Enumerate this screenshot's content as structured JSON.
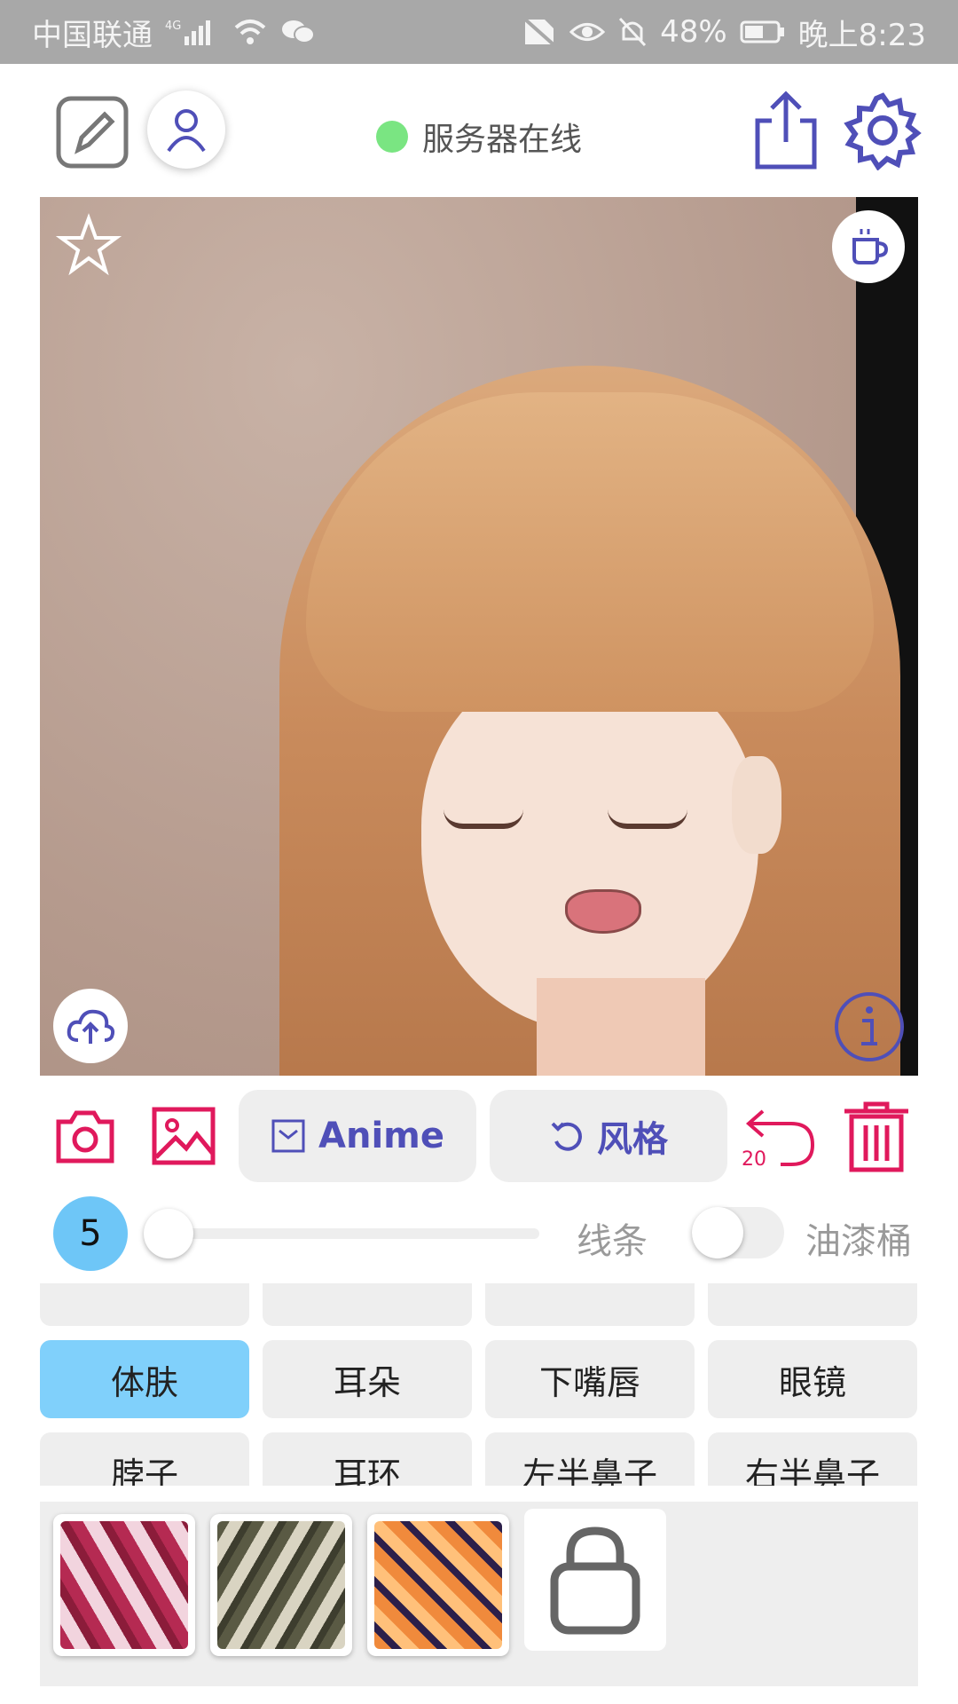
{
  "status_bar": {
    "carrier": "中国联通",
    "network": "4G",
    "battery": "48%",
    "time": "晚上8:23"
  },
  "header": {
    "server_status": "服务器在线",
    "status_color": "#7ae582"
  },
  "toolbar": {
    "mode_label": "Anime",
    "style_label": "风格",
    "undo_count": "20",
    "accent_color": "#e0195c",
    "primary_color": "#4f4fb8"
  },
  "brush": {
    "size": "5",
    "line_label": "线条",
    "bucket_label": "油漆桶",
    "bucket_enabled": false
  },
  "parts": {
    "selected": "体肤",
    "row1": [
      "体肤",
      "耳朵",
      "下嘴唇",
      "眼镜"
    ],
    "row2": [
      "脖子",
      "耳环",
      "左半鼻子",
      "右半鼻子"
    ]
  },
  "swatches": {
    "items": [
      "red-marble-texture",
      "gray-camo-texture",
      "orange-tiger-texture"
    ],
    "locked_icon": "lock-icon"
  }
}
